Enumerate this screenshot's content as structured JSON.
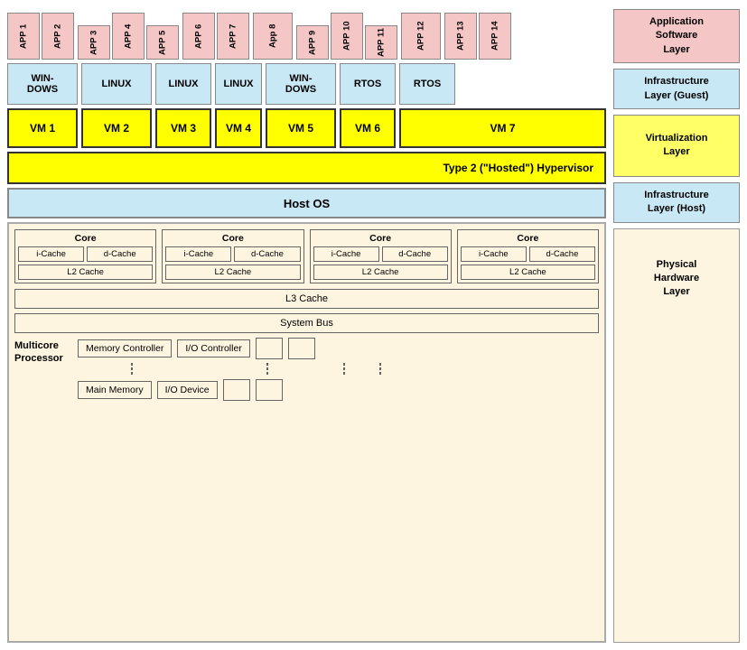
{
  "legend": {
    "app_layer": "Application\nSoftware\nLayer",
    "infra_guest": "Infrastructure\nLayer (Guest)",
    "virt_layer": "Virtualization\nLayer",
    "infra_host": "Infrastructure\nLayer (Host)",
    "phys_layer": "Physical\nHardware\nLayer"
  },
  "apps": {
    "group1": [
      "APP 1",
      "APP 2"
    ],
    "group2": [
      "APP 3",
      "APP 4",
      "APP 5"
    ],
    "group3": [
      "APP 6",
      "APP 7"
    ],
    "group4": [
      "App 8"
    ],
    "group5": [
      "APP 9",
      "APP 10",
      "APP 11"
    ],
    "group6": [
      "APP 12"
    ],
    "group7": [
      "APP 13",
      "APP 14"
    ]
  },
  "os_boxes": [
    "WIN-\nDOWS",
    "LINUX",
    "LINUX",
    "LINUX",
    "WIN-\nDOWS",
    "RTOS",
    "RTOS"
  ],
  "vms": [
    "VM 1",
    "VM 2",
    "VM 3",
    "VM 4",
    "VM 5",
    "VM 6",
    "VM 7"
  ],
  "hypervisor": "Type 2 (\"Hosted\") Hypervisor",
  "host_os": "Host OS",
  "cores": [
    {
      "title": "Core",
      "icache": "i-Cache",
      "dcache": "d-Cache",
      "l2": "L2 Cache"
    },
    {
      "title": "Core",
      "icache": "i-Cache",
      "dcache": "d-Cache",
      "l2": "L2 Cache"
    },
    {
      "title": "Core",
      "icache": "i-Cache",
      "dcache": "d-Cache",
      "l2": "L2 Cache"
    },
    {
      "title": "Core",
      "icache": "i-Cache",
      "dcache": "d-Cache",
      "l2": "L2 Cache"
    }
  ],
  "l3_cache": "L3 Cache",
  "system_bus": "System Bus",
  "multicore_label": "Multicore\nProcessor",
  "memory_controller": "Memory Controller",
  "io_controller": "I/O Controller",
  "main_memory": "Main Memory",
  "io_device": "I/O Device"
}
